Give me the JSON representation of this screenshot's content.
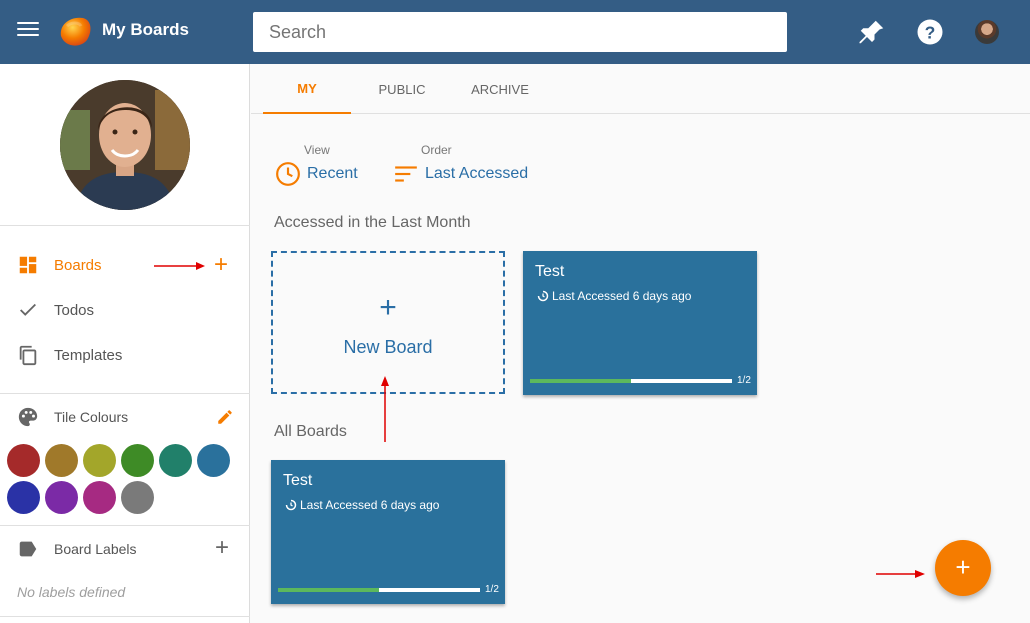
{
  "app": {
    "title": "My Boards"
  },
  "search": {
    "placeholder": "Search"
  },
  "sidebar": {
    "nav": [
      {
        "label": "Boards",
        "icon": "dashboard-icon",
        "active": true
      },
      {
        "label": "Todos",
        "icon": "check-icon"
      },
      {
        "label": "Templates",
        "icon": "copy-icon"
      }
    ],
    "add_board_symbol": "+",
    "tile_colours_title": "Tile Colours",
    "colours": [
      "#a52a2a",
      "#a0792a",
      "#a3a62a",
      "#3e8b26",
      "#21806a",
      "#2a719c",
      "#2a32a6",
      "#7b2aa6",
      "#a62a82",
      "#7a7a7a"
    ],
    "board_labels_title": "Board Labels",
    "add_label_symbol": "+",
    "no_labels_text": "No labels defined"
  },
  "tabs": [
    {
      "label": "MY",
      "active": true
    },
    {
      "label": "PUBLIC"
    },
    {
      "label": "ARCHIVE"
    }
  ],
  "view": {
    "label": "View",
    "value": "Recent"
  },
  "order": {
    "label": "Order",
    "value": "Last Accessed"
  },
  "recent_section": {
    "heading": "Accessed in the Last Month",
    "new_board_symbol": "+",
    "new_board_label": "New Board",
    "boards": [
      {
        "title": "Test",
        "subtitle": "Last Accessed 6 days ago",
        "progress": 0.5,
        "progress_text": "1/2",
        "color": "#2a719c"
      }
    ]
  },
  "all_section": {
    "heading": "All Boards",
    "boards": [
      {
        "title": "Test",
        "subtitle": "Last Accessed 6 days ago",
        "progress": 0.5,
        "progress_text": "1/2",
        "color": "#2a719c"
      }
    ]
  },
  "fab": {
    "symbol": "+"
  },
  "accent_colors": {
    "primary": "#345d85",
    "accent": "#f57c00",
    "link": "#2a6ea6",
    "annotation_arrow": "#e00000"
  }
}
